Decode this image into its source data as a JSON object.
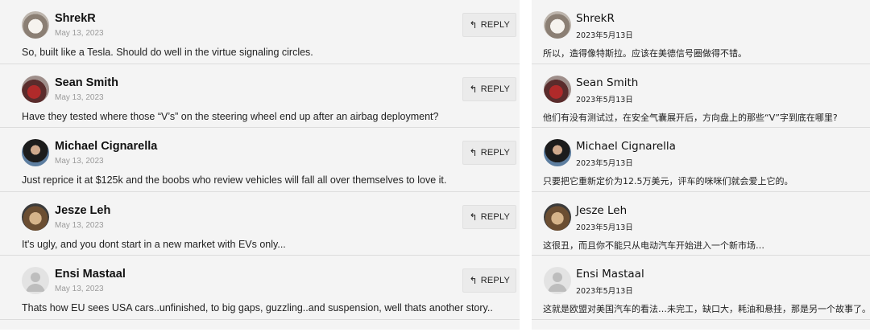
{
  "reply_label": "REPLY",
  "reply_icon": "reply-arrow-icon",
  "left_panel": {
    "comments": [
      {
        "name": "ShrekR",
        "date": "May 13, 2023",
        "text": "So, built like a Tesla. Should do well in the virtue signaling circles.",
        "avatar": "user-photo"
      },
      {
        "name": "Sean Smith",
        "date": "May 13, 2023",
        "text": "Have they tested where those “V’s” on the steering wheel end up after an airbag deployment?",
        "avatar": "user-photo"
      },
      {
        "name": "Michael Cignarella",
        "date": "May 13, 2023",
        "text": "Just reprice it at $125k and the boobs who review vehicles will fall all over themselves to love it.",
        "avatar": "user-photo"
      },
      {
        "name": "Jesze Leh",
        "date": "May 13, 2023",
        "text": "It's ugly, and you dont start in a new market with EVs only...",
        "avatar": "user-photo"
      },
      {
        "name": "Ensi Mastaal",
        "date": "May 13, 2023",
        "text": "Thats how EU sees USA cars..unfinished, to big gaps, guzzling..and suspension, well thats another story..",
        "avatar": "default-user-icon"
      }
    ]
  },
  "right_panel": {
    "comments": [
      {
        "name": "ShrekR",
        "date": "2023年5月13日",
        "text": "所以，造得像特斯拉。应该在美德信号圈做得不错。"
      },
      {
        "name": "Sean Smith",
        "date": "2023年5月13日",
        "text": "他们有没有测试过，在安全气囊展开后，方向盘上的那些“V”字到底在哪里?"
      },
      {
        "name": "Michael Cignarella",
        "date": "2023年5月13日",
        "text": "只要把它重新定价为12.5万美元，评车的咪咪们就会爱上它的。"
      },
      {
        "name": "Jesze Leh",
        "date": "2023年5月13日",
        "text": "这很丑，而且你不能只从电动汽车开始进入一个新市场…"
      },
      {
        "name": "Ensi Mastaal",
        "date": "2023年5月13日",
        "text": "这就是欧盟对美国汽车的看法…未完工，缺口大，耗油和悬挂，那是另一个故事了。"
      }
    ]
  },
  "colors": {
    "panel_bg": "#f4f4f4",
    "divider": "#dcdcdc",
    "reply_bg": "#ebebeb",
    "date_en": "#9a9a9a"
  }
}
